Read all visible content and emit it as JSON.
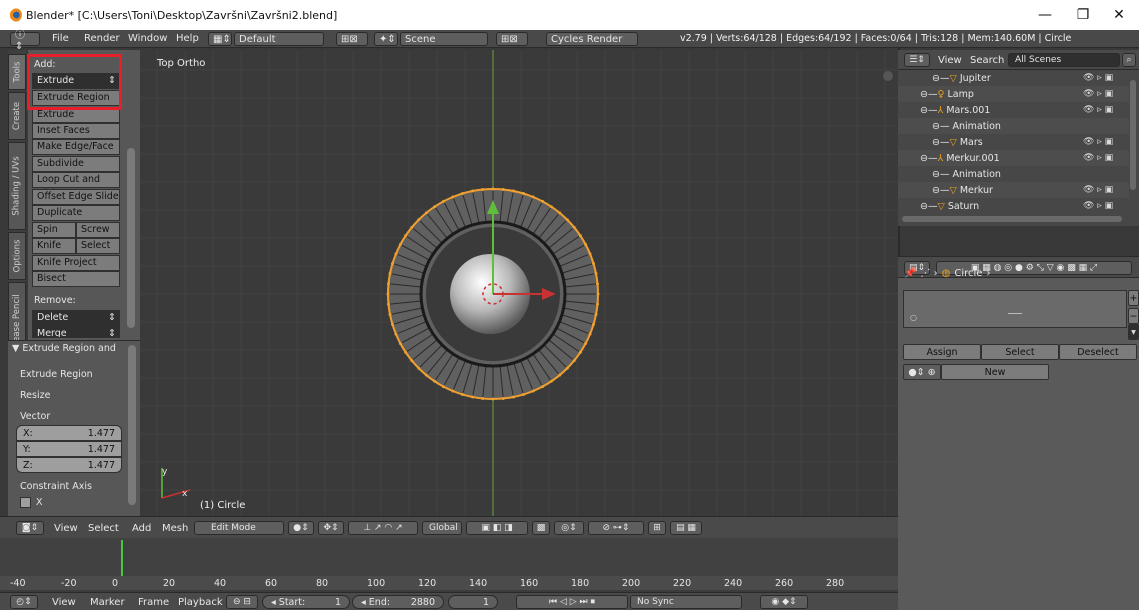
{
  "window": {
    "title": "Blender* [C:\\Users\\Toni\\Desktop\\Završni\\Završni2.blend]",
    "minimize": "—",
    "maximize": "❐",
    "close": "✕"
  },
  "info_header": {
    "menus": [
      "File",
      "Render",
      "Window",
      "Help"
    ],
    "layout": "Default",
    "scene": "Scene",
    "engine": "Cycles Render",
    "stats": "v2.79 | Verts:64/128 | Edges:64/192 | Faces:0/64 | Tris:128 | Mem:140.60M | Circle"
  },
  "toolshelf": {
    "tabs": [
      "Tools",
      "Create",
      "Shading / UVs",
      "Options",
      "Grease Pencil"
    ],
    "add_label": "Add:",
    "extrude": "Extrude",
    "extrude_region": "Extrude Region",
    "extrude_individual": "Extrude Individual",
    "inset_faces": "Inset Faces",
    "make_edge_face": "Make Edge/Face",
    "subdivide": "Subdivide",
    "loop_cut": "Loop Cut and Slide",
    "offset_edge": "Offset Edge Slide",
    "duplicate": "Duplicate",
    "spin": "Spin",
    "screw": "Screw",
    "knife": "Knife",
    "select": "Select",
    "knife_project": "Knife Project",
    "bisect": "Bisect",
    "remove_label": "Remove:",
    "delete": "Delete",
    "merge": "Merge"
  },
  "operator": {
    "title": "▼ Extrude Region and",
    "extrude_region": "Extrude Region",
    "resize": "Resize",
    "vector_label": "Vector",
    "x_label": "X:",
    "x_value": "1.477",
    "y_label": "Y:",
    "y_value": "1.477",
    "z_label": "Z:",
    "z_value": "1.477",
    "constraint_label": "Constraint Axis",
    "x_axis": "X"
  },
  "viewport": {
    "view_name": "Top Ortho",
    "object_label": "(1) Circle"
  },
  "vp_header": {
    "menus": [
      "View",
      "Select",
      "Add",
      "Mesh"
    ],
    "mode": "Edit Mode",
    "orientation": "Global"
  },
  "timeline": {
    "ruler": [
      "-40",
      "-20",
      "0",
      "20",
      "40",
      "60",
      "80",
      "100",
      "120",
      "140",
      "160",
      "180",
      "200",
      "220",
      "240",
      "260",
      "280"
    ],
    "menus": [
      "View",
      "Marker",
      "Frame",
      "Playback"
    ],
    "start_label": "Start:",
    "start_value": "1",
    "end_label": "End:",
    "end_value": "2880",
    "current_frame": "1",
    "sync": "No Sync"
  },
  "outliner": {
    "menus": [
      "View",
      "Search"
    ],
    "filter": "All Scenes",
    "rows": [
      "Jupiter",
      "Lamp",
      "Mars.001",
      "Animation",
      "Mars",
      "Merkur.001",
      "Animation",
      "Merkur",
      "Saturn"
    ]
  },
  "properties": {
    "breadcrumb": "Circle",
    "assign": "Assign",
    "select": "Select",
    "deselect": "Deselect",
    "new": "New"
  },
  "colors": {
    "accent_red": "#e5202a",
    "edge_orange": "#f0a030",
    "axis_green": "#5fbf3a",
    "axis_red": "#c83232"
  }
}
